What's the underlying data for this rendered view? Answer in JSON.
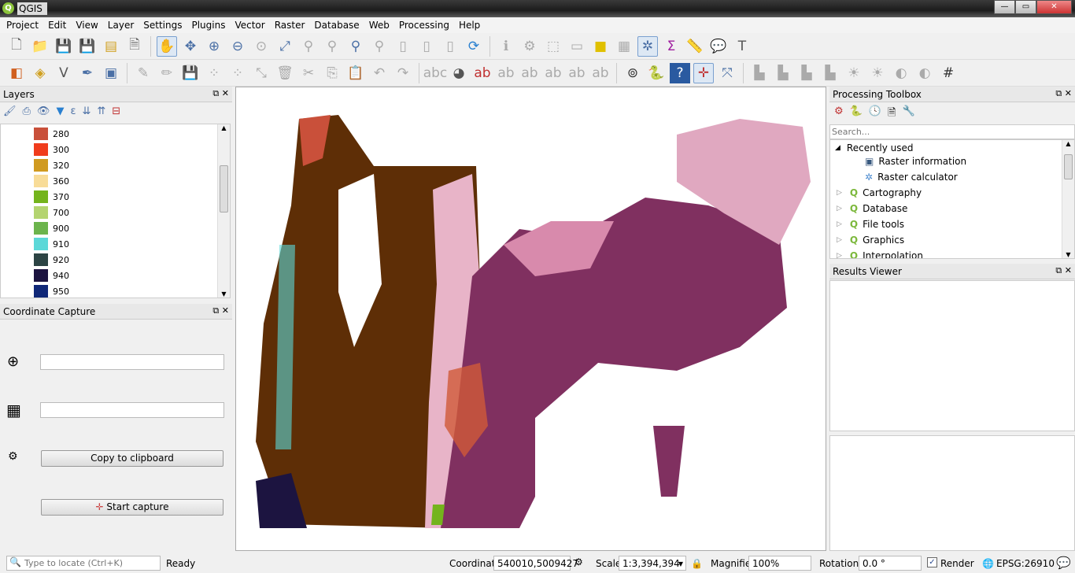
{
  "window": {
    "title": "QGIS",
    "controls": [
      "minimize",
      "maximize",
      "close"
    ]
  },
  "menu": [
    "Project",
    "Edit",
    "View",
    "Layer",
    "Settings",
    "Plugins",
    "Vector",
    "Raster",
    "Database",
    "Web",
    "Processing",
    "Help"
  ],
  "layers_panel": {
    "title": "Layers",
    "legend": [
      {
        "label": "280",
        "color": "#c9503a"
      },
      {
        "label": "300",
        "color": "#f03c1c"
      },
      {
        "label": "320",
        "color": "#d09a20"
      },
      {
        "label": "360",
        "color": "#f8dc98"
      },
      {
        "label": "370",
        "color": "#74b41c"
      },
      {
        "label": "700",
        "color": "#b4d470"
      },
      {
        "label": "900",
        "color": "#6cb44c"
      },
      {
        "label": "910",
        "color": "#5cd8d8"
      },
      {
        "label": "920",
        "color": "#2c4444"
      },
      {
        "label": "940",
        "color": "#1c1440"
      },
      {
        "label": "950",
        "color": "#102878"
      }
    ]
  },
  "coord_panel": {
    "title": "Coordinate Capture",
    "field1": "",
    "field2": "",
    "copy": "Copy to clipboard",
    "start": "Start capture"
  },
  "processing": {
    "title": "Processing Toolbox",
    "search_placeholder": "Search...",
    "recent": "Recently used",
    "recent_items": [
      "Raster information",
      "Raster calculator"
    ],
    "groups": [
      "Cartography",
      "Database",
      "File tools",
      "Graphics",
      "Interpolation"
    ]
  },
  "results": {
    "title": "Results Viewer"
  },
  "status": {
    "locate_placeholder": "Type to locate (Ctrl+K)",
    "ready": "Ready",
    "coord_label": "Coordinate",
    "coord": "540010,5009427",
    "scale_label": "Scale",
    "scale": "1:3,394,394",
    "magnifier_label": "Magnifier",
    "magnifier": "100%",
    "rotation_label": "Rotation",
    "rotation": "0.0 °",
    "render": "Render",
    "render_checked": true,
    "crs": "EPSG:26910"
  },
  "map_colors": {
    "brown": "#5e2e06",
    "purple": "#803060",
    "pink": "#e8b4c8",
    "orange": "#d05a38"
  }
}
